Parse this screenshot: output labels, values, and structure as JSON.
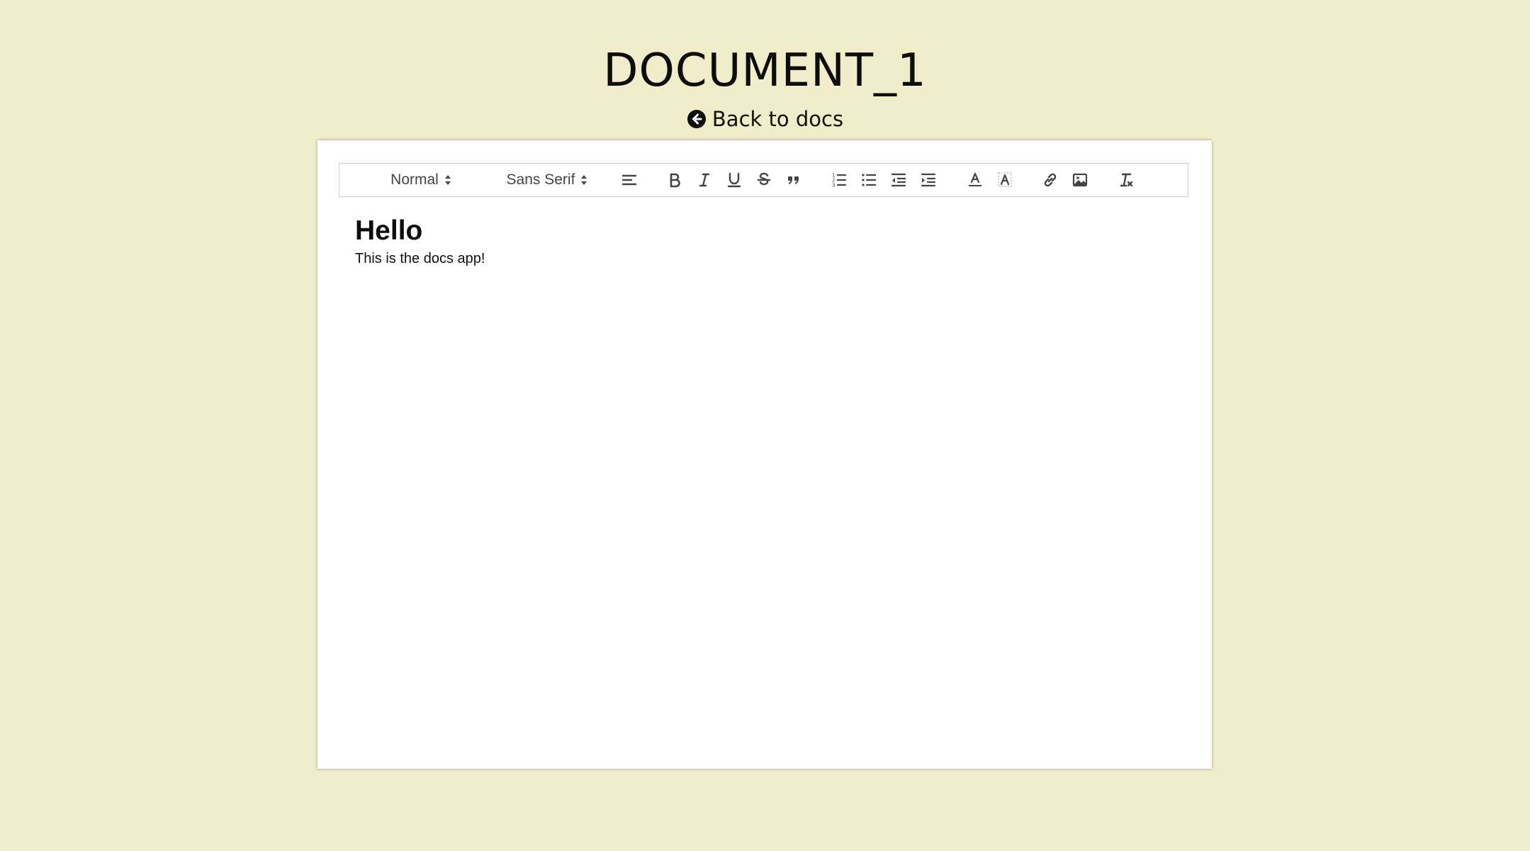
{
  "page": {
    "title": "DOCUMENT_1",
    "back_label": "Back to docs"
  },
  "toolbar": {
    "header_picker": "Normal",
    "font_picker": "Sans Serif",
    "buttons": [
      {
        "name": "align-left-icon"
      },
      {
        "name": "bold-icon"
      },
      {
        "name": "italic-icon"
      },
      {
        "name": "underline-icon"
      },
      {
        "name": "strikethrough-icon"
      },
      {
        "name": "blockquote-icon"
      },
      {
        "name": "ordered-list-icon"
      },
      {
        "name": "bullet-list-icon"
      },
      {
        "name": "outdent-icon"
      },
      {
        "name": "indent-icon"
      },
      {
        "name": "text-color-icon"
      },
      {
        "name": "background-color-icon"
      },
      {
        "name": "link-icon"
      },
      {
        "name": "image-icon"
      },
      {
        "name": "clear-formatting-icon"
      }
    ]
  },
  "editor": {
    "heading": "Hello",
    "paragraph": "This is the docs app!"
  },
  "colors": {
    "background": "#f1ecc9",
    "paper": "#ffffff",
    "toolbar_border": "#cccccc",
    "icon": "#444444"
  }
}
